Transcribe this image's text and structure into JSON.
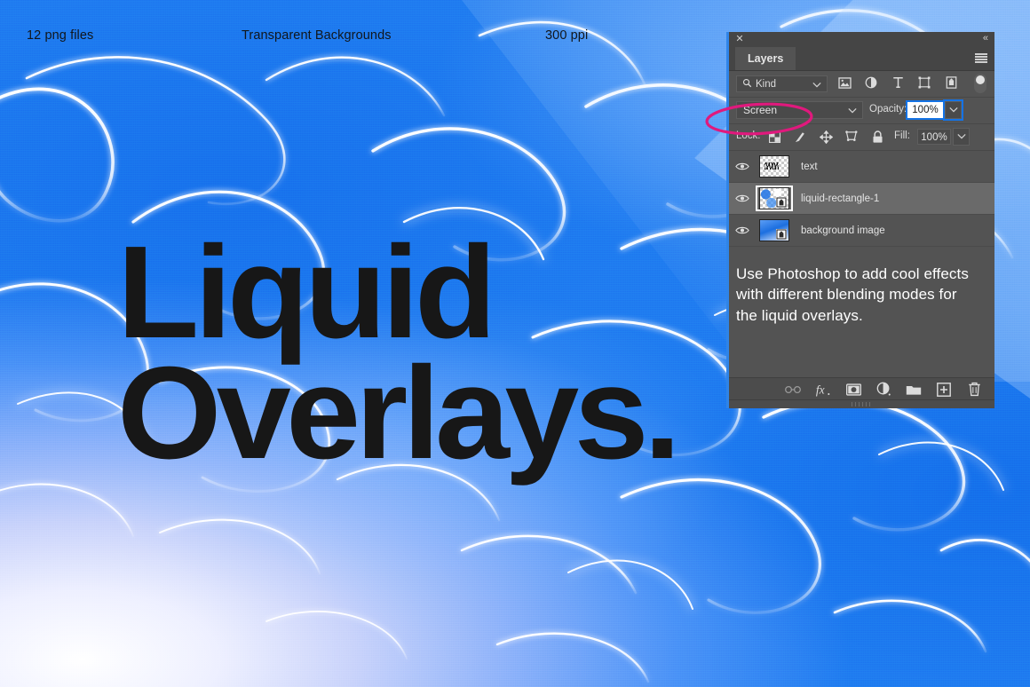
{
  "header": {
    "labels": [
      {
        "text": "12 png files",
        "name": "header-label-png-files"
      },
      {
        "text": "Transparent Backgrounds",
        "name": "header-label-transparent"
      },
      {
        "text": "300 ppi",
        "name": "header-label-ppi"
      }
    ]
  },
  "headline": {
    "line1": "Liquid",
    "line2": "Overlays."
  },
  "panel": {
    "title": "Layers",
    "close_label": "✕",
    "collapse_label": "«",
    "menu_icon": "hamburger-menu-icon",
    "filter": {
      "search_icon": "search-icon",
      "kind_label": "Kind",
      "chevron": "chevron-down-icon",
      "icons": [
        "pixel-layer-filter-icon",
        "adjustment-layer-filter-icon",
        "type-layer-filter-icon",
        "shape-layer-filter-icon",
        "smart-object-filter-icon"
      ],
      "toggle": "filter-enable-toggle"
    },
    "blend": {
      "mode": "Screen",
      "opacity_label": "Opacity:",
      "opacity_value": "100%",
      "chevron": "chevron-down-icon"
    },
    "lock": {
      "label": "Lock:",
      "icons": [
        "lock-transparent-pixels-icon",
        "lock-image-pixels-icon",
        "lock-position-icon",
        "lock-artboard-nesting-icon",
        "lock-all-icon"
      ],
      "fill_label": "Fill:",
      "fill_value": "100%"
    },
    "layers": [
      {
        "name": "text",
        "visible": true,
        "selected": false,
        "thumb": "transparent-text-thumbnail",
        "linked": false
      },
      {
        "name": "liquid-rectangle-1",
        "visible": true,
        "selected": true,
        "thumb": "transparent-liquid-thumbnail",
        "linked": true
      },
      {
        "name": "background image",
        "visible": true,
        "selected": false,
        "thumb": "blue-gradient-thumbnail",
        "linked": true
      }
    ],
    "description": "Use Photoshop to add cool effects with different blending modes for the liquid overlays.",
    "bottom_icons": [
      "link-layers-icon",
      "layer-style-fx-icon",
      "layer-mask-icon",
      "new-adjustment-layer-icon",
      "new-group-icon",
      "new-layer-icon",
      "delete-layer-icon"
    ]
  },
  "annotation": {
    "shape": "magenta-ellipse-highlight",
    "color": "#e0197d",
    "target": "blend-mode-screen"
  },
  "colors": {
    "panel_bg": "#535353",
    "panel_header": "#454545",
    "selected_row": "#6a6a6a",
    "accent_blue": "#2f84e8",
    "annotation_pink": "#e0197d",
    "headline_ink": "#171717",
    "liquid_blue": "#1f7bf0"
  }
}
